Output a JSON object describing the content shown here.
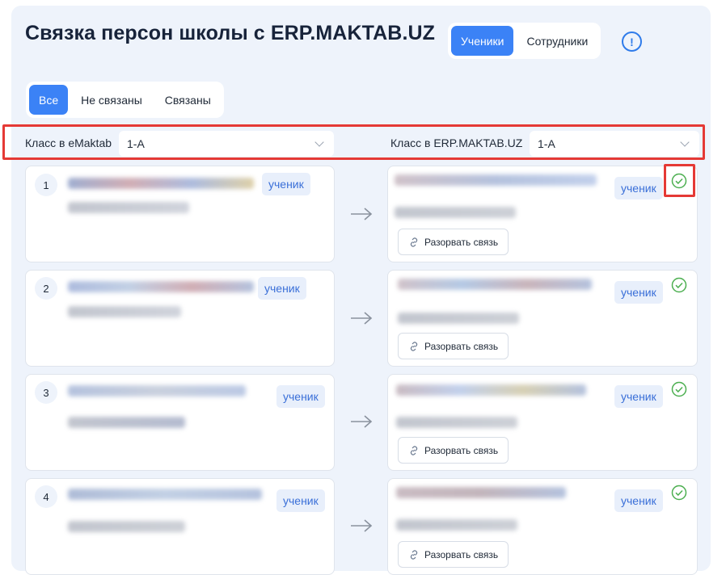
{
  "header": {
    "title": "Связка персон школы с ERP.MAKTAB.UZ",
    "tabs": [
      "Ученики",
      "Сотрудники"
    ],
    "active_tab": 0,
    "info_icon": "info-circle-icon"
  },
  "filter": {
    "tabs": [
      "Все",
      "Не связаны",
      "Связаны"
    ],
    "active": 0
  },
  "class_select": {
    "left_label": "Класс в eMaktab",
    "left_value": "1-A",
    "right_label": "Класс в ERP.MAKTAB.UZ",
    "right_value": "1-A"
  },
  "rows": [
    {
      "num": "1",
      "left_badge": "ученик",
      "right_badge": "ученик",
      "unlink_label": "Разорвать связь",
      "linked": true
    },
    {
      "num": "2",
      "left_badge": "ученик",
      "right_badge": "ученик",
      "unlink_label": "Разорвать связь",
      "linked": true
    },
    {
      "num": "3",
      "left_badge": "ученик",
      "right_badge": "ученик",
      "unlink_label": "Разорвать связь",
      "linked": true
    },
    {
      "num": "4",
      "left_badge": "ученик",
      "right_badge": "ученик",
      "unlink_label": "Разорвать связь",
      "linked": true
    }
  ],
  "colors": {
    "accent": "#3b82f6",
    "success": "#4caf50",
    "highlight": "#e53935"
  }
}
